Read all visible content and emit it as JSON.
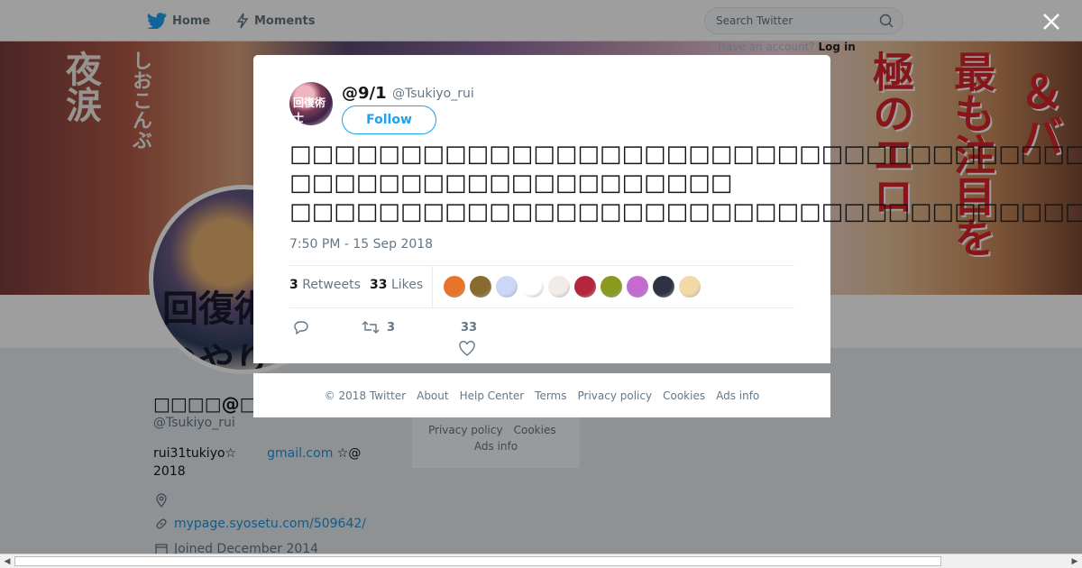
{
  "nav": {
    "home_label": "Home",
    "moments_label": "Moments",
    "search_placeholder": "Search Twitter",
    "login_prompt": "Have an account?",
    "login_link": "Log in"
  },
  "banner": {
    "text_1": "夜涙",
    "text_2": "しおこんぶ",
    "text_3": "極のエロ",
    "text_4": "最も注目を",
    "text_5": "＆バ"
  },
  "profile": {
    "avatar_text": "回復術士のやり直し",
    "name": "□□□□@□□□",
    "handle": "@Tsukiyo_rui",
    "bio_part1": "rui31tukiyo☆",
    "bio_link": "gmail.com",
    "bio_part2": "☆@",
    "bio_line2": "2018",
    "url": "mypage.syosetu.com/509642/",
    "joined": "Joined December 2014"
  },
  "side_footer": {
    "privacy": "Privacy policy",
    "cookies": "Cookies",
    "ads": "Ads info"
  },
  "tweet": {
    "avatar_text": "回復術士",
    "name": "@9/1",
    "handle": "@Tsukiyo_rui",
    "follow_label": "Follow",
    "text_line1": "□□□□□□□□□□□□□□□□□□□□□□□□□□□□□□□□□□□□",
    "text_line2": "□□□□□□□□□□□□□□□□□□□□",
    "text_line3": "□□□□□□□□□□□□□□□□□□□□□□□□□□□□□□□□□□□□□□□□□□□□□□□",
    "timestamp": "7:50 PM - 15 Sep 2018",
    "retweets_count": "3",
    "retweets_label": "Retweets",
    "likes_count": "33",
    "likes_label": "Likes",
    "action_retweet_count": "3",
    "action_like_count": "33"
  },
  "likers": [
    {
      "color": "#e8742a"
    },
    {
      "color": "#8a6a2e"
    },
    {
      "color": "#ccd6f6"
    },
    {
      "color": "#ffffff"
    },
    {
      "color": "#f1ece8"
    },
    {
      "color": "#b3263c"
    },
    {
      "color": "#8a9a1e"
    },
    {
      "color": "#c46ad0"
    },
    {
      "color": "#2e3242"
    },
    {
      "color": "#f4d9a8"
    }
  ],
  "footer": {
    "copyright": "© 2018 Twitter",
    "about": "About",
    "help": "Help Center",
    "terms": "Terms",
    "privacy": "Privacy policy",
    "cookies": "Cookies",
    "ads": "Ads info"
  }
}
